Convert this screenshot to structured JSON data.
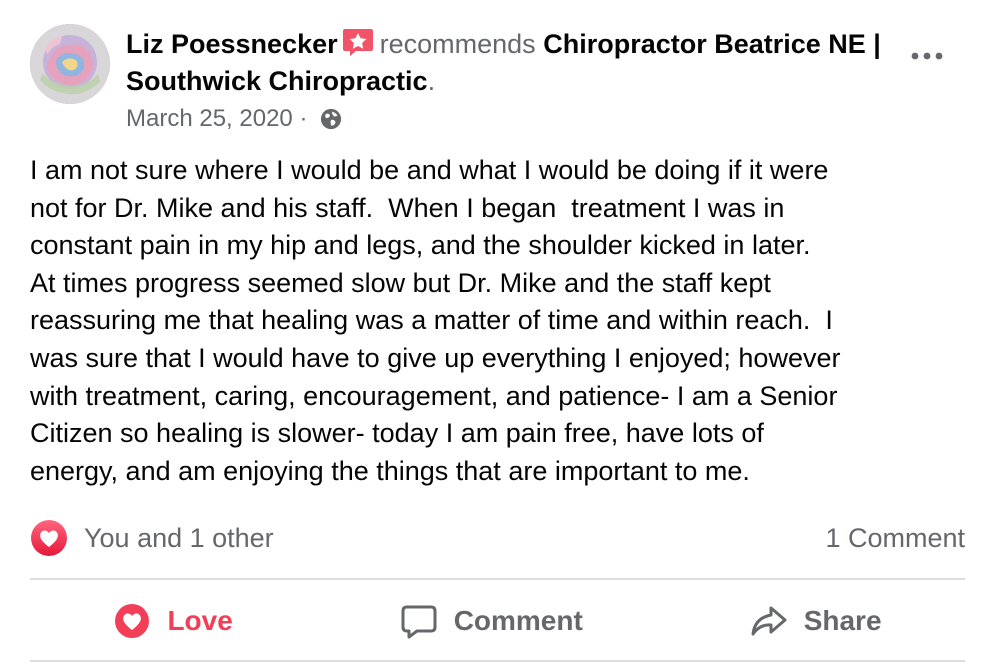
{
  "post": {
    "author": "Liz Poessnecker",
    "verb": "recommends",
    "page_name": "Chiropractor Beatrice NE | Southwick Chiropractic",
    "page_name_suffix": ".",
    "date": "March 25, 2020",
    "date_separator": " · ",
    "privacy_icon": "globe-icon",
    "recommend_badge_icon": "star-speech-bubble-icon",
    "more_icon": "more-options-icon",
    "body": "I am not sure where I would be and what I would be doing if it were\nnot for Dr. Mike and his staff.  When I began  treatment I was in\nconstant pain in my hip and legs, and the shoulder kicked in later.\nAt times progress seemed slow but Dr. Mike and the staff kept\nreassuring me that healing was a matter of time and within reach.  I\nwas sure that I would have to give up everything I enjoyed; however\nwith treatment, caring, encouragement, and patience- I am a Senior\nCitizen so healing is slower- today I am pain free, have lots of\nenergy, and am enjoying the things that are important to me."
  },
  "stats": {
    "reaction_icon": "love-reaction-icon",
    "reactions_text": "You and 1 other",
    "comments_text": "1 Comment"
  },
  "actions": {
    "love_label": "Love",
    "comment_label": "Comment",
    "share_label": "Share"
  },
  "colors": {
    "love_red": "#f33e58",
    "badge_pink": "#f35369",
    "muted_gray": "#65676b",
    "divider": "#dadde1"
  }
}
